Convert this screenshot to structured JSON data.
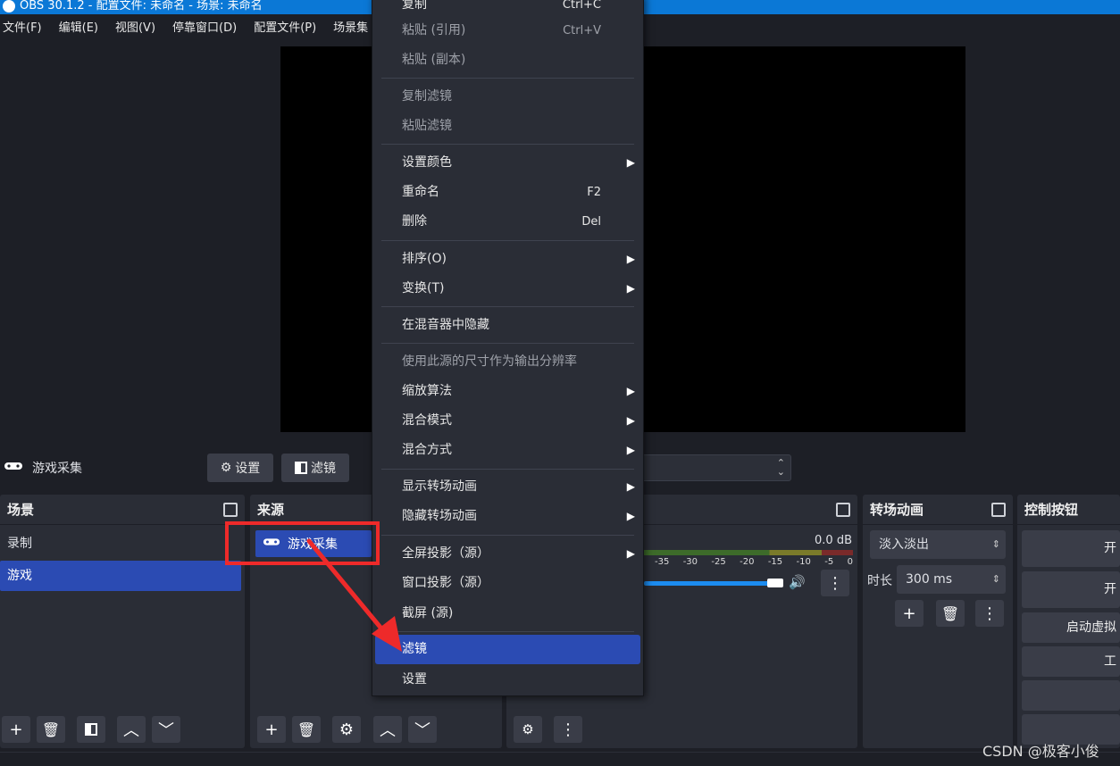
{
  "window": {
    "title": "OBS 30.1.2 - 配置文件: 未命名 - 场景: 未命名"
  },
  "menubar": [
    "文件(F)",
    "编辑(E)",
    "视图(V)",
    "停靠窗口(D)",
    "配置文件(P)",
    "场景集"
  ],
  "source_toolbar": {
    "name": "游戏采集",
    "settings": "设置",
    "filters": "滤镜"
  },
  "scenes": {
    "title": "场景",
    "items": [
      "录制",
      "游戏"
    ],
    "selected": 1
  },
  "sources": {
    "title": "来源",
    "items": [
      "游戏采集"
    ]
  },
  "audio_mixer": {
    "level": "0.0 dB",
    "ticks": [
      "-35",
      "-30",
      "-25",
      "-20",
      "-15",
      "-10",
      "-5",
      "0"
    ]
  },
  "transitions": {
    "title": "转场动画",
    "selected": "淡入淡出",
    "duration_label": "时长",
    "duration": "300 ms"
  },
  "controls": {
    "title": "控制按钮",
    "btn1": "开",
    "btn2": "开",
    "btn3": "启动虚拟",
    "btn4": "工"
  },
  "context_menu": {
    "copy": "复制",
    "copy_sc": "Ctrl+C",
    "paste_ref": "粘贴 (引用)",
    "paste_ref_sc": "Ctrl+V",
    "paste_dup": "粘贴 (副本)",
    "copy_filters": "复制滤镜",
    "paste_filters": "粘贴滤镜",
    "set_color": "设置颜色",
    "rename": "重命名",
    "rename_sc": "F2",
    "delete": "删除",
    "delete_sc": "Del",
    "order": "排序(O)",
    "transform": "变换(T)",
    "hide_mixer": "在混音器中隐藏",
    "use_size": "使用此源的尺寸作为输出分辨率",
    "scale_filter": "缩放算法",
    "blend_mode": "混合模式",
    "blend_method": "混合方式",
    "show_transition": "显示转场动画",
    "hide_transition": "隐藏转场动画",
    "fullscreen_projector": "全屏投影（源）",
    "window_projector": "窗口投影（源）",
    "screenshot": "截屏 (源)",
    "filters": "滤镜",
    "properties": "设置"
  },
  "watermark": "CSDN @极客小俊",
  "colors": {
    "accent": "#2b4bb3",
    "annotation": "#ee2a2a",
    "titlebar": "#0b78d6"
  }
}
